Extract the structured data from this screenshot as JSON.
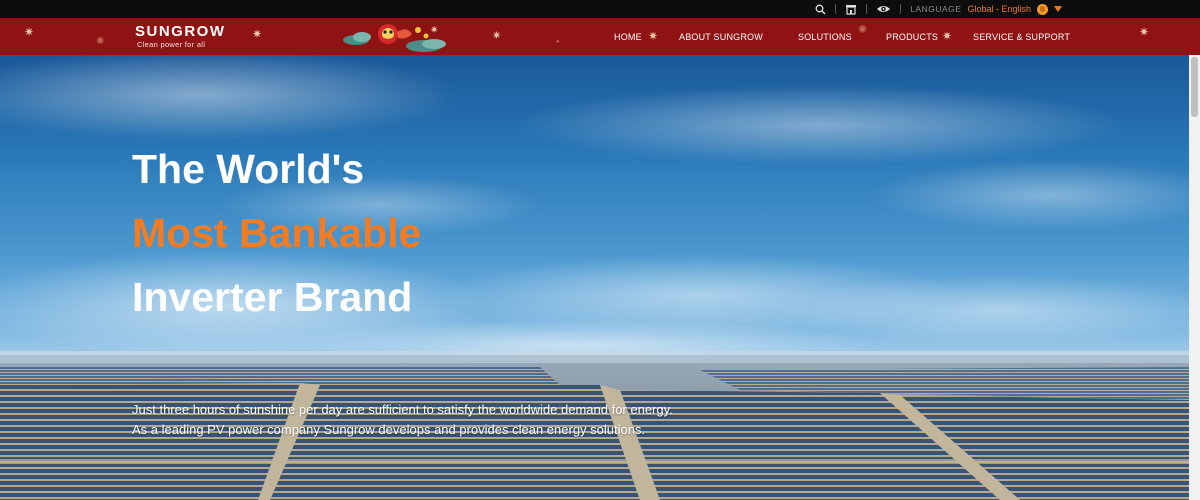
{
  "utility_bar": {
    "language_label": "LANGUAGE",
    "language_value": "Global - English",
    "icons": [
      "search-icon",
      "store-icon",
      "eye-icon",
      "globe-icon",
      "caret-down-icon"
    ],
    "accent_color": "#f07a1a"
  },
  "header": {
    "logo_text": "SUNGROW",
    "logo_tagline": "Clean power for all",
    "background_color": "#8f1313",
    "nav": [
      {
        "label": "HOME"
      },
      {
        "label": "ABOUT SUNGROW"
      },
      {
        "label": "SOLUTIONS"
      },
      {
        "label": "PRODUCTS"
      },
      {
        "label": "SERVICE & SUPPORT"
      }
    ]
  },
  "hero": {
    "line1": "The World's",
    "line2": "Most Bankable",
    "line3": "Inverter Brand",
    "accent_color": "#f47b20",
    "description_line1": "Just three hours of sunshine per day are sufficient to satisfy the worldwide demand for energy.",
    "description_line2": "As a leading PV power company Sungrow develops and provides clean energy solutions."
  }
}
